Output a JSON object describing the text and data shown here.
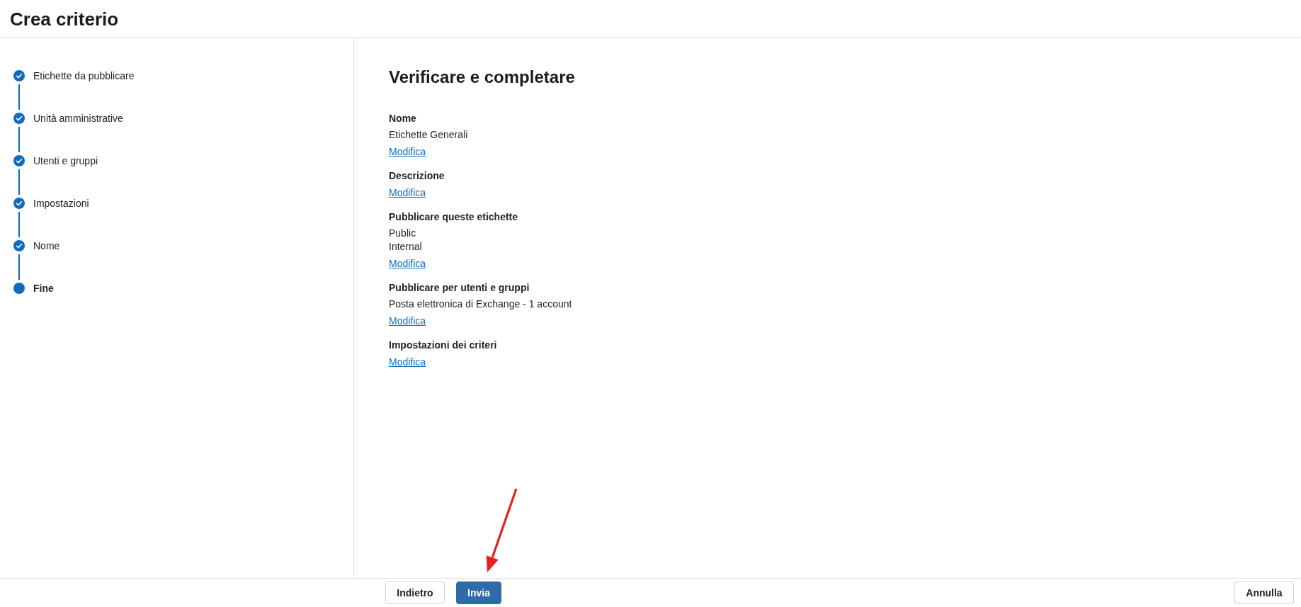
{
  "window": {
    "title": "Crea criterio"
  },
  "steps": [
    {
      "label": "Etichette da pubblicare",
      "completed": true,
      "selected": false
    },
    {
      "label": "Unità amministrative",
      "completed": true,
      "selected": false
    },
    {
      "label": "Utenti e gruppi",
      "completed": true,
      "selected": false
    },
    {
      "label": "Impostazioni",
      "completed": true,
      "selected": false
    },
    {
      "label": "Nome",
      "completed": true,
      "selected": false
    },
    {
      "label": "Fine",
      "completed": false,
      "selected": true
    }
  ],
  "review": {
    "heading": "Verificare e completare",
    "sections": [
      {
        "label": "Nome",
        "values": [
          "Etichette Generali"
        ],
        "link": "Modifica"
      },
      {
        "label": "Descrizione",
        "link": "Modifica"
      },
      {
        "label": "Pubblicare queste etichette",
        "values": [
          "Public",
          "Internal"
        ],
        "link": "Modifica"
      },
      {
        "label": "Pubblicare per utenti e gruppi",
        "values": [
          "Posta elettronica di Exchange - 1 account"
        ],
        "link": "Modifica"
      },
      {
        "label": "Impostazioni dei criteri",
        "link": "Modifica"
      }
    ]
  },
  "footer": {
    "buttons": [
      {
        "label": "Indietro",
        "kind": "secondary"
      },
      {
        "label": "Invia",
        "kind": "primary"
      }
    ],
    "end_buttons": [
      {
        "label": "Annulla",
        "kind": "secondary"
      }
    ]
  }
}
